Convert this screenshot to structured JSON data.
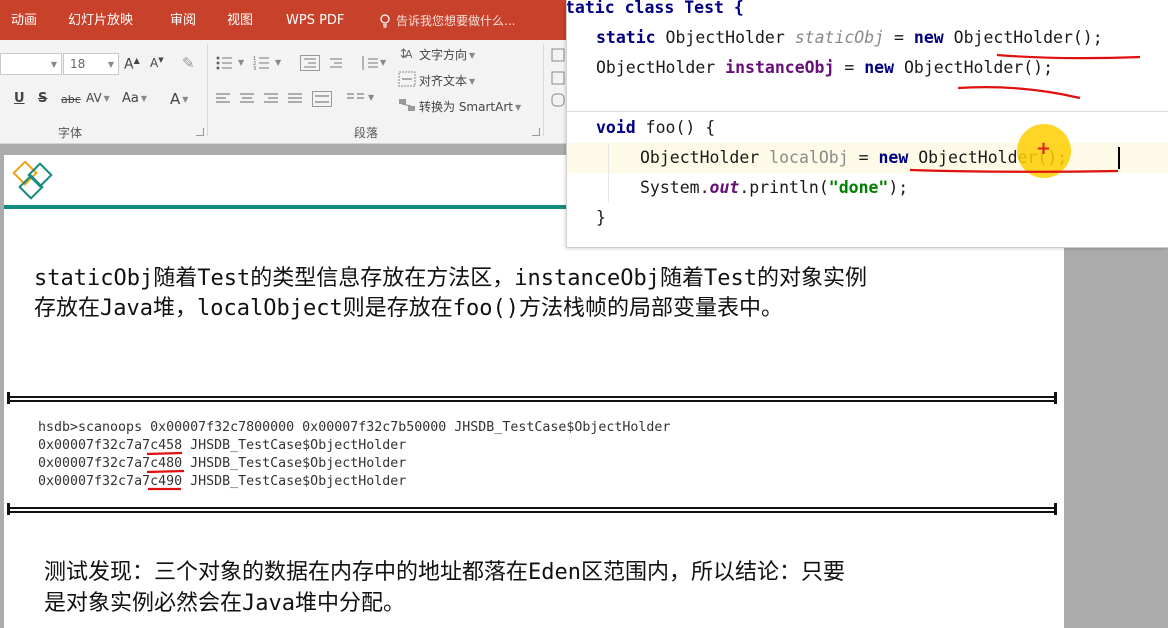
{
  "menubar": {
    "items": [
      "动画",
      "幻灯片放映",
      "审阅",
      "视图",
      "WPS PDF"
    ],
    "tell_me": "告诉我您想要做什么..."
  },
  "ribbon": {
    "font_size": "18",
    "text_direction": "文字方向",
    "align_text": "对齐文本",
    "convert_smartart": "转换为 SmartArt",
    "font_group_label": "字体",
    "paragraph_group_label": "段落",
    "change_case": "Aa",
    "char_spacing": "AV",
    "font_color": "A",
    "bold_u": "U",
    "bold_s": "S",
    "abc": "abc"
  },
  "editor": {
    "lines": {
      "class_decl": "tatic class Test {",
      "static_kw": "static",
      "type1": "ObjectHolder",
      "var1": "staticObj",
      "eq1": " = ",
      "new1": "new",
      "ctor1": " ObjectHolder();",
      "type2": "ObjectHolder",
      "var2": "instanceObj",
      "eq2": " = ",
      "new2": "new",
      "ctor2": " ObjectHolder();",
      "void_kw": "void",
      "method": " foo() {",
      "type3": "ObjectHolder",
      "var3": "localObj",
      "eq3": " = ",
      "new3": "new",
      "ctor3": " ObjectHolder();",
      "sys": "System.",
      "out": "out",
      "println": ".println(",
      "str": "\"done\"",
      "end": ");",
      "close": "}"
    }
  },
  "slide": {
    "para1_line1": [
      "staticObj",
      "随着",
      "Test",
      "的类型信息存放在方法区，",
      "instanceObj",
      "随着",
      "Test",
      "的对象实例"
    ],
    "para1_line2": [
      "存放在",
      "Java",
      "堆，",
      "localObject",
      "则是存放在",
      "foo()",
      "方法栈帧的局部变量表中。"
    ],
    "hsdb_lines": [
      "hsdb>scanoops 0x00007f32c7800000 0x00007f32c7b50000 JHSDB_TestCase$ObjectHolder",
      "0x00007f32c7a7c458 JHSDB_TestCase$ObjectHolder",
      "0x00007f32c7a7c480 JHSDB_TestCase$ObjectHolder",
      "0x00007f32c7a7c490 JHSDB_TestCase$ObjectHolder"
    ],
    "para2_line1": [
      "测试发现：三个对象的数据在内存中的地址都落在",
      "Eden",
      "区范围内，所以结论：只要"
    ],
    "para2_line2": [
      "是对象实例必然会在",
      "Java",
      "堆中分配。"
    ]
  },
  "colors": {
    "menubar": "#c8412a",
    "accent_teal": "#158a80",
    "annotation_red": "#e01010",
    "cursor_highlight": "#ffce00"
  }
}
